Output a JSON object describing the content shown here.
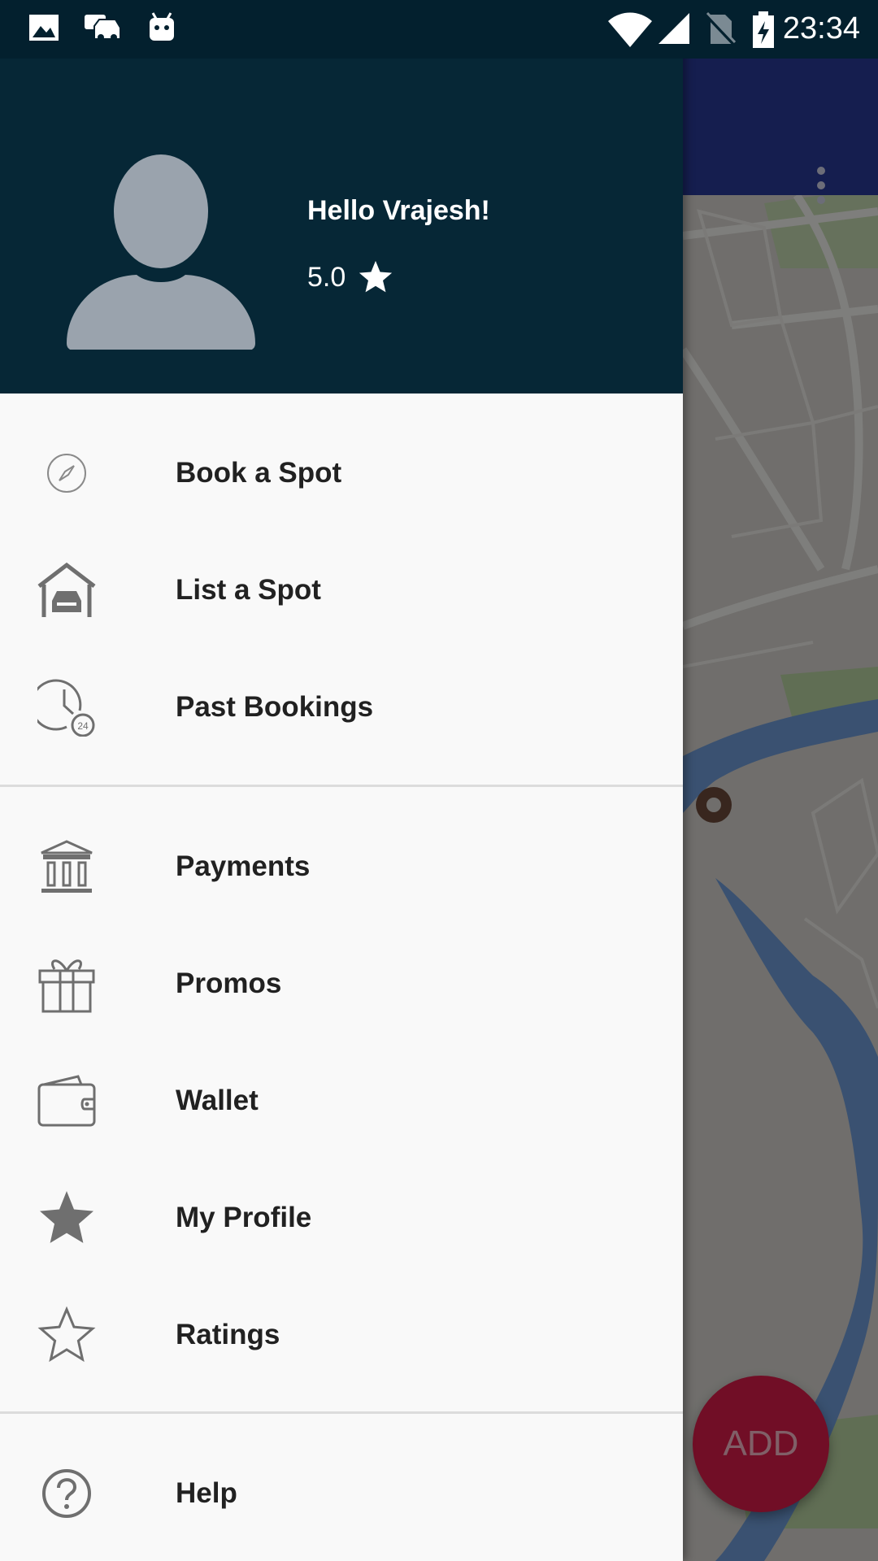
{
  "status_bar": {
    "time": "23:34",
    "icons": [
      "image-icon",
      "car-sync-icon",
      "android-debug-icon",
      "wifi-icon",
      "signal-icon",
      "no-sim-icon",
      "battery-charging-icon"
    ]
  },
  "header": {
    "greeting": "Hello Vrajesh!",
    "rating": "5.0"
  },
  "menu_sections": [
    [
      {
        "label": "Book a Spot",
        "icon": "compass-icon"
      },
      {
        "label": "List a Spot",
        "icon": "garage-icon"
      },
      {
        "label": "Past Bookings",
        "icon": "clock-24-icon"
      }
    ],
    [
      {
        "label": "Payments",
        "icon": "bank-icon"
      },
      {
        "label": "Promos",
        "icon": "gift-icon"
      },
      {
        "label": "Wallet",
        "icon": "wallet-icon"
      },
      {
        "label": "My Profile",
        "icon": "star-filled-icon"
      },
      {
        "label": "Ratings",
        "icon": "star-outline-icon"
      }
    ],
    [
      {
        "label": "Help",
        "icon": "help-icon"
      }
    ]
  ],
  "fab": {
    "label": "ADD"
  },
  "colors": {
    "status_bar": "#03202e",
    "drawer_header": "#062736",
    "app_bar": "#2a3a97",
    "fab": "#d81b4a",
    "drawer_bg": "#f9f9f9",
    "icon_gray": "#6f6f6f"
  }
}
